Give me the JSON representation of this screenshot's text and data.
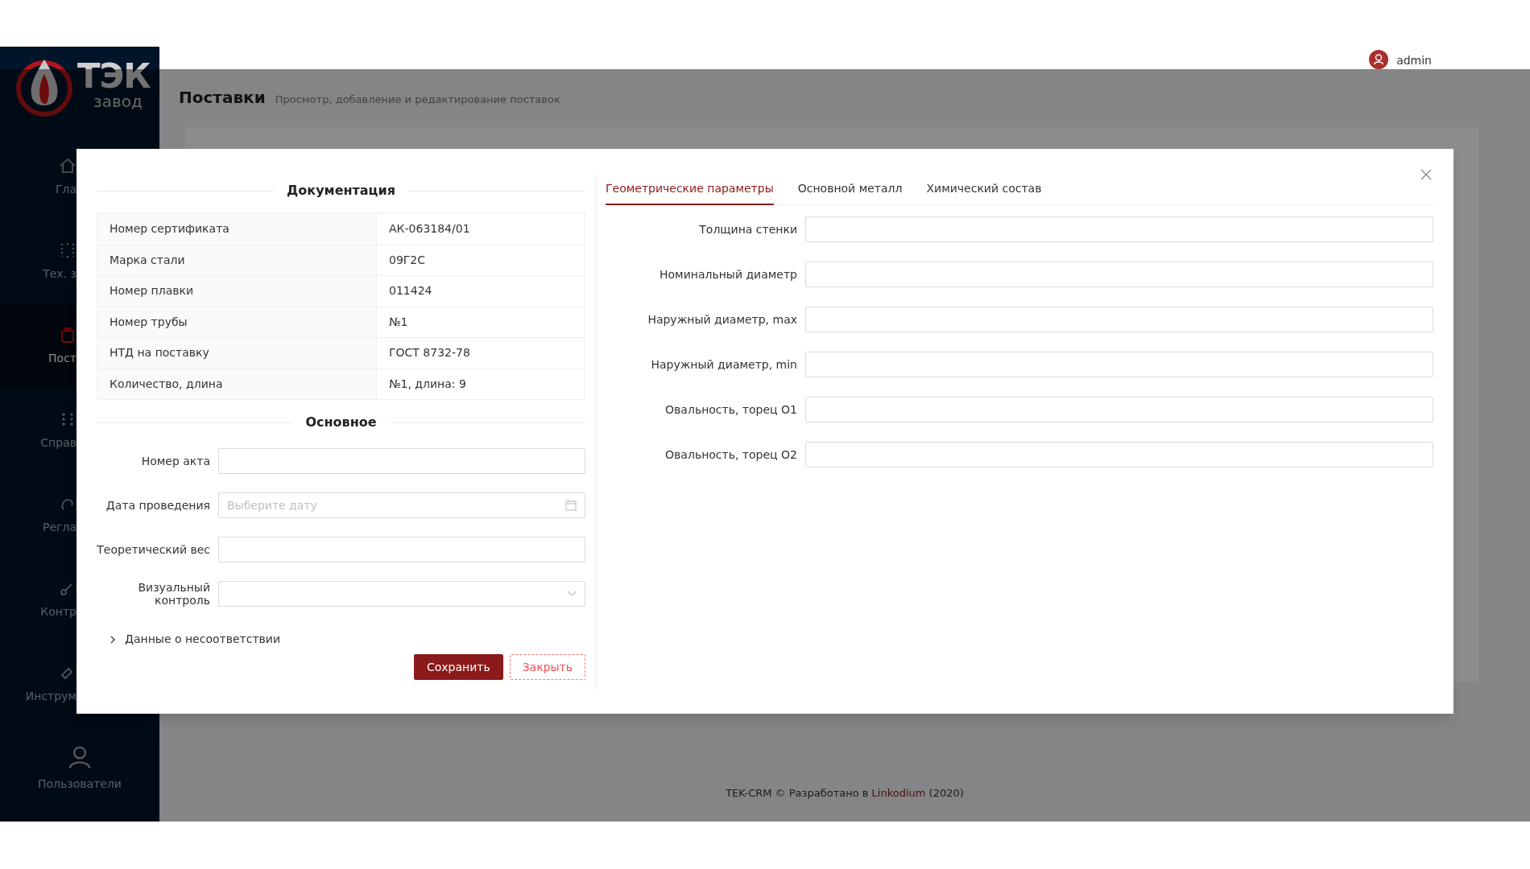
{
  "brand": {
    "logo_main": "ТЭК",
    "logo_sub": "завод"
  },
  "sidebar": {
    "items": [
      {
        "label": "Гла",
        "selected": false
      },
      {
        "label": "Тех. з",
        "selected": false
      },
      {
        "label": "Пост",
        "selected": true
      },
      {
        "label": "Справ",
        "selected": false
      },
      {
        "label": "Регла",
        "selected": false
      },
      {
        "label": "Контр",
        "selected": false
      },
      {
        "label": "Инструм",
        "selected": false
      },
      {
        "label": "Пользователи",
        "selected": false
      }
    ]
  },
  "header": {
    "user": "admin"
  },
  "page": {
    "title": "Поставки",
    "subtitle": "Просмотр, добавление и редактирование поставок"
  },
  "footer": {
    "text": "TEK-CRM © Разработано в",
    "link": "Linkodium",
    "year": "(2020)"
  },
  "modal": {
    "documentation": {
      "title": "Документация",
      "rows": [
        {
          "label": "Номер сертификата",
          "value": "АК-063184/01"
        },
        {
          "label": "Марка стали",
          "value": "09Г2С"
        },
        {
          "label": "Номер плавки",
          "value": "011424"
        },
        {
          "label": "Номер трубы",
          "value": "№1"
        },
        {
          "label": "НТД на поставку",
          "value": "ГОСТ 8732-78"
        },
        {
          "label": "Количество, длина",
          "value": "№1, длина: 9"
        }
      ]
    },
    "main": {
      "title": "Основное",
      "fields": [
        {
          "kind": "text",
          "label": "Номер акта"
        },
        {
          "kind": "date",
          "label": "Дата проведения",
          "placeholder": "Выберите дату"
        },
        {
          "kind": "text",
          "label": "Теоретический вес"
        },
        {
          "kind": "select",
          "label": "Визуальный контроль"
        }
      ]
    },
    "collapse": {
      "label": "Данные о несоответствии",
      "expanded": false
    },
    "buttons": [
      {
        "kind": "primary",
        "label": "Сохранить"
      },
      {
        "kind": "dashed",
        "label": "Закрыть"
      }
    ],
    "tabs": [
      {
        "label": "Геометрические параметры",
        "selected": true
      },
      {
        "label": "Основной металл",
        "selected": false
      },
      {
        "label": "Химический состав",
        "selected": false
      }
    ],
    "geometry_fields": [
      {
        "label": "Толщина стенки"
      },
      {
        "label": "Номинальный диаметр"
      },
      {
        "label": "Наружный диаметр, max"
      },
      {
        "label": "Наружный диаметр, min"
      },
      {
        "label": "Овальность, торец О1"
      },
      {
        "label": "Овальность, торец О2"
      }
    ]
  }
}
